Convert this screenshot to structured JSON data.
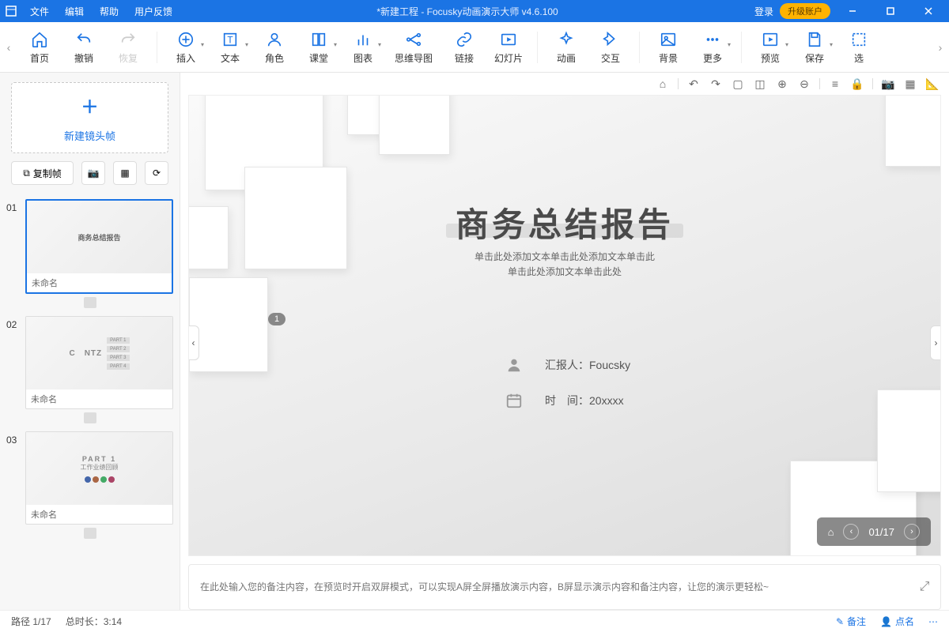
{
  "menu": {
    "file": "文件",
    "edit": "编辑",
    "help": "帮助",
    "feedback": "用户反馈"
  },
  "title": "*新建工程 - Focusky动画演示大师  v4.6.100",
  "login": "登录",
  "upgrade": "升级账户",
  "toolbar": {
    "home": "首页",
    "undo": "撤销",
    "redo": "恢复",
    "insert": "插入",
    "text": "文本",
    "role": "角色",
    "class": "课堂",
    "chart": "图表",
    "mindmap": "思维导图",
    "link": "链接",
    "slide": "幻灯片",
    "anim": "动画",
    "interact": "交互",
    "bg": "背景",
    "more": "更多",
    "preview": "预览",
    "save": "保存",
    "select": "选​"
  },
  "sidebar": {
    "newframe": "新建镜头帧",
    "copyframe": "复制帧",
    "thumbs": [
      {
        "num": "01",
        "name": "未命名",
        "preview_title": "商务总结报告"
      },
      {
        "num": "02",
        "name": "未命名",
        "preview_title": "C NTZ",
        "parts": [
          "PART 1",
          "PART 2",
          "PART 3",
          "PART 4"
        ]
      },
      {
        "num": "03",
        "name": "未命名",
        "preview_title": "PART 1",
        "preview_sub": "工作业绩回顾"
      }
    ]
  },
  "slide": {
    "title": "商务总结报告",
    "sub1": "单击此处添加文本单击此处添加文本单击此",
    "sub2": "单击此处添加文本单击此处",
    "presenter_label": "汇报人：",
    "presenter_name": "Foucsky",
    "date_label": "时　间：",
    "date_value": "20xxxx",
    "badge": "1"
  },
  "nav": {
    "page": "01/17"
  },
  "notes": {
    "placeholder": "在此处输入您的备注内容，在预览时开启双屏模式，可以实现A屏全屏播放演示内容，B屏显示演示内容和备注内容，让您的演示更轻松~"
  },
  "status": {
    "path": "路径 1/17",
    "totaltime": "总时长：3:14",
    "remark": "备注",
    "roll": "点名"
  }
}
